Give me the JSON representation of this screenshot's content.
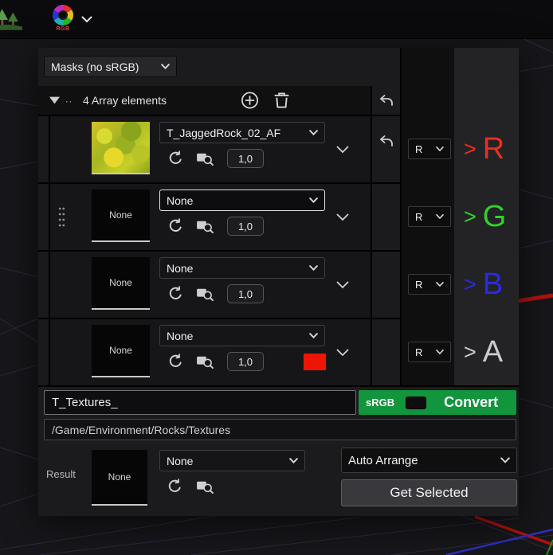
{
  "topbar": {
    "rgb_icon_label": "RGB"
  },
  "dialog": {
    "masks_dropdown": {
      "label": "Masks (no sRGB)"
    },
    "array_header": {
      "grip": "..",
      "label": "4 Array elements"
    },
    "rows": [
      {
        "thumb_label": "",
        "asset_dropdown": "T_JaggedRock_02_AF",
        "weight": "1,0",
        "channel_dropdown": "R",
        "out_prefix": ">",
        "out_letter": "R",
        "out_color": "#ee2e1e"
      },
      {
        "thumb_label": "None",
        "asset_dropdown": "None",
        "weight": "1,0",
        "channel_dropdown": "R",
        "out_prefix": ">",
        "out_letter": "G",
        "out_color": "#2ed32a"
      },
      {
        "thumb_label": "None",
        "asset_dropdown": "None",
        "weight": "1,0",
        "channel_dropdown": "R",
        "out_prefix": ">",
        "out_letter": "B",
        "out_color": "#2a2ae6"
      },
      {
        "thumb_label": "None",
        "asset_dropdown": "None",
        "weight": "1,0",
        "channel_dropdown": "R",
        "out_prefix": ">",
        "out_letter": "A",
        "out_color": "#cccccc",
        "swatch_color": "#ee1506"
      }
    ],
    "name_input": {
      "value": "T_Textures_"
    },
    "srgb_bar": {
      "srgb_label": "sRGB",
      "convert_label": "Convert",
      "green": "#12953d"
    },
    "path_input": {
      "value": "/Game/Environment/Rocks/Textures"
    },
    "result": {
      "label": "Result",
      "thumb_label": "None",
      "asset_dropdown": "None",
      "auto_arrange": "Auto Arrange",
      "get_selected": "Get Selected"
    }
  }
}
